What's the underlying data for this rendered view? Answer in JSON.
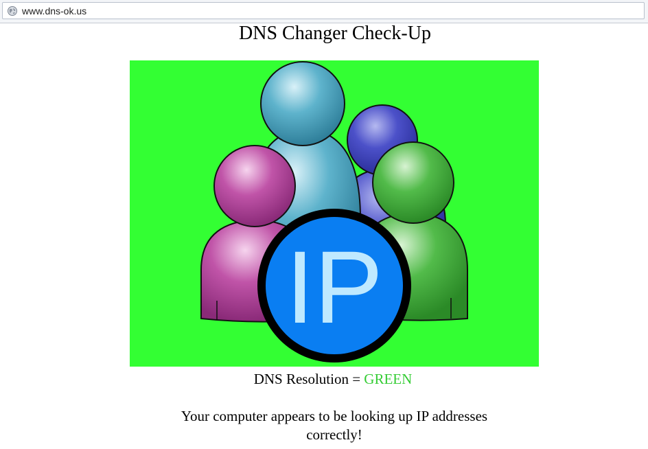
{
  "browser": {
    "url": "www.dns-ok.us",
    "site_icon": "globe-icon"
  },
  "page": {
    "title": "DNS Changer Check-Up",
    "hero_background": "#33ff33",
    "hero_icon": "ip-users-icon",
    "ip_badge_label": "IP",
    "resolution_label": "DNS Resolution = ",
    "resolution_status": "GREEN",
    "resolution_status_color": "#33cc33",
    "message": "Your computer appears to be looking up IP addresses correctly!"
  }
}
